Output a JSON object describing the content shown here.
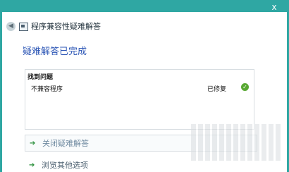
{
  "window": {
    "close_glyph": "x"
  },
  "nav": {
    "title": "程序兼容性疑难解答",
    "back_glyph": "◀"
  },
  "heading": "疑难解答已完成",
  "results": {
    "header": "找到问题",
    "rows": [
      {
        "name": "不兼容程序",
        "status": "已修复",
        "status_icon": "check-icon"
      }
    ]
  },
  "actions": {
    "close_label": "关闭疑难解答",
    "explore_label": "浏览其他选项",
    "arrow_glyph": "➔"
  },
  "colors": {
    "accent": "#2fa7a3",
    "heading": "#2b55b5",
    "success": "#58a832"
  }
}
